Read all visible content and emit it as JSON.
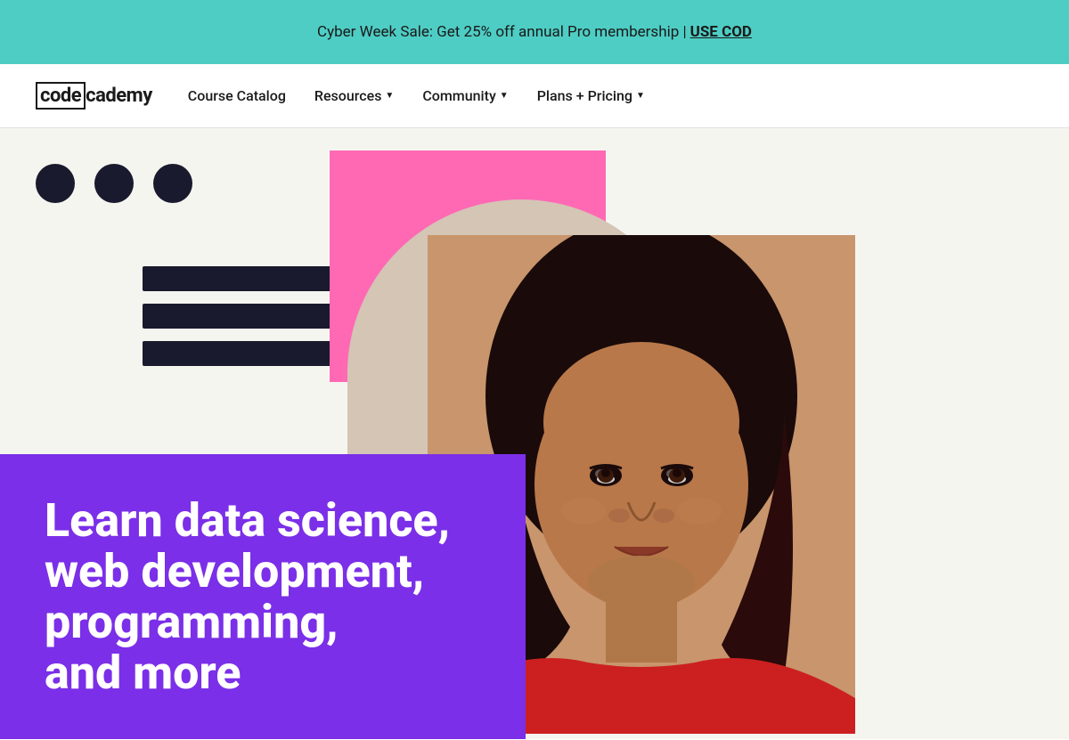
{
  "banner": {
    "text": "Cyber Week Sale: Get 25% off annual Pro membership | ",
    "cta": "USE COD",
    "bg_color": "#4ecdc4"
  },
  "navbar": {
    "logo_code": "code",
    "logo_suffix": "cademy",
    "links": [
      {
        "id": "course-catalog",
        "label": "Course Catalog",
        "has_dropdown": false
      },
      {
        "id": "resources",
        "label": "Resources",
        "has_dropdown": true
      },
      {
        "id": "community",
        "label": "Community",
        "has_dropdown": true
      },
      {
        "id": "plans-pricing",
        "label": "Plans + Pricing",
        "has_dropdown": true
      }
    ]
  },
  "hero": {
    "headline_line1": "Learn data science,",
    "headline_line2": "web development,",
    "headline_line3": "programming,",
    "headline_line4": "and more",
    "card_bg": "#7b2fe8"
  },
  "colors": {
    "teal": "#4ecdc4",
    "purple": "#7b2fe8",
    "pink": "#e879c0",
    "dark": "#1a1a2e",
    "beige": "#d4c5b5",
    "white": "#ffffff"
  }
}
